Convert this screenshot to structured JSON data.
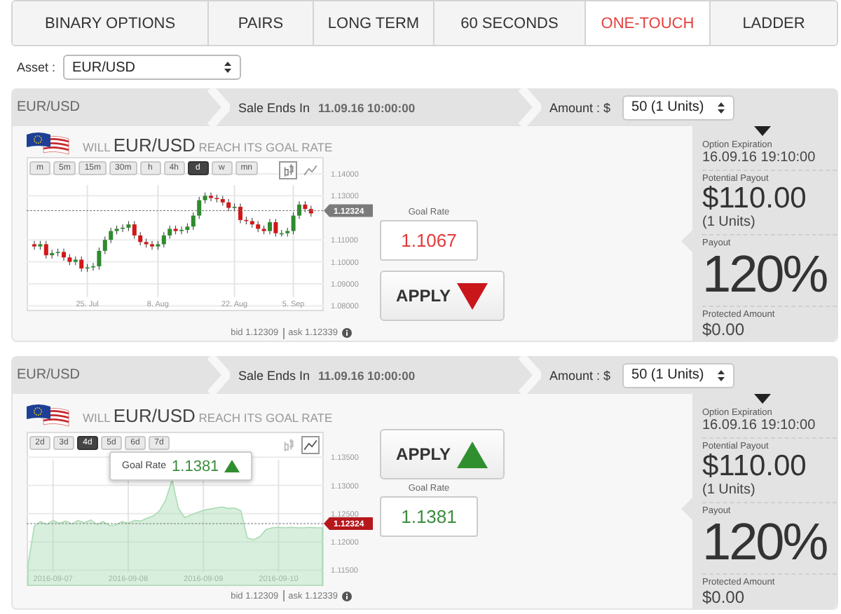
{
  "tabs": [
    {
      "label": "BINARY OPTIONS",
      "selected": false
    },
    {
      "label": "PAIRS",
      "selected": false
    },
    {
      "label": "LONG TERM",
      "selected": false
    },
    {
      "label": "60 SECONDS",
      "selected": false
    },
    {
      "label": "ONE-TOUCH",
      "selected": true
    },
    {
      "label": "LADDER",
      "selected": false
    }
  ],
  "asset": {
    "label": "Asset :",
    "value": "EUR/USD"
  },
  "panels": [
    {
      "header": {
        "symbol": "EUR/USD",
        "sale_label": "Sale Ends In",
        "sale_time": "11.09.16 10:00:00",
        "amount_label": "Amount : $",
        "amount_value": "50 (1 Units)"
      },
      "question": {
        "prefix": "WILL",
        "symbol": "EUR/USD",
        "suffix": "REACH ITS GOAL RATE"
      },
      "timeframes": [
        {
          "label": "m",
          "selected": false
        },
        {
          "label": "5m",
          "selected": false
        },
        {
          "label": "15m",
          "selected": false
        },
        {
          "label": "30m",
          "selected": false
        },
        {
          "label": "h",
          "selected": false
        },
        {
          "label": "4h",
          "selected": false
        },
        {
          "label": "d",
          "selected": true
        },
        {
          "label": "w",
          "selected": false
        },
        {
          "label": "mn",
          "selected": false
        }
      ],
      "chart_types": [
        {
          "kind": "candlestick",
          "selected": true
        },
        {
          "kind": "line",
          "selected": false
        }
      ],
      "chart_data": {
        "type": "candlestick",
        "categories": [
          null,
          null,
          null,
          null,
          null,
          null,
          null,
          null,
          null,
          "25. Jul",
          null,
          null,
          null,
          null,
          null,
          null,
          null,
          null,
          null,
          null,
          null,
          "8. Aug",
          null,
          null,
          null,
          null,
          null,
          null,
          null,
          null,
          null,
          null,
          null,
          null,
          "22. Aug",
          null,
          null,
          null,
          null,
          null,
          null,
          null,
          null,
          null,
          "5. Sep",
          null,
          null,
          null
        ],
        "ohlc": [
          [
            1.108,
            1.1095,
            1.1055,
            1.107
          ],
          [
            1.107,
            1.1095,
            1.1055,
            1.108
          ],
          [
            1.108,
            1.1095,
            1.1015,
            1.103
          ],
          [
            1.103,
            1.1055,
            1.1015,
            1.104
          ],
          [
            1.104,
            1.106,
            1.1025,
            1.1045
          ],
          [
            1.1045,
            1.106,
            1.1005,
            1.102
          ],
          [
            1.102,
            1.1035,
            1.0985,
            1.1
          ],
          [
            1.1,
            1.1025,
            1.0985,
            1.101
          ],
          [
            1.101,
            1.1025,
            1.0955,
            1.097
          ],
          [
            1.097,
            1.099,
            1.0955,
            1.0975
          ],
          [
            1.0975,
            1.0995,
            1.096,
            1.098
          ],
          [
            1.098,
            1.1065,
            1.0965,
            1.105
          ],
          [
            1.105,
            1.1115,
            1.1035,
            1.11
          ],
          [
            1.11,
            1.1155,
            1.1085,
            1.114
          ],
          [
            1.114,
            1.1165,
            1.1125,
            1.115
          ],
          [
            1.115,
            1.117,
            1.1135,
            1.1155
          ],
          [
            1.1155,
            1.1185,
            1.114,
            1.117
          ],
          [
            1.117,
            1.1185,
            1.1105,
            1.112
          ],
          [
            1.112,
            1.1135,
            1.1075,
            1.109
          ],
          [
            1.109,
            1.1105,
            1.1065,
            1.108
          ],
          [
            1.108,
            1.1095,
            1.1055,
            1.107
          ],
          [
            1.107,
            1.1095,
            1.1055,
            1.108
          ],
          [
            1.108,
            1.1135,
            1.1065,
            1.112
          ],
          [
            1.112,
            1.1165,
            1.1105,
            1.115
          ],
          [
            1.115,
            1.1165,
            1.1125,
            1.114
          ],
          [
            1.114,
            1.116,
            1.1125,
            1.1145
          ],
          [
            1.1145,
            1.1175,
            1.113,
            1.116
          ],
          [
            1.116,
            1.1225,
            1.1145,
            1.121
          ],
          [
            1.121,
            1.1295,
            1.1195,
            1.128
          ],
          [
            1.128,
            1.1315,
            1.1265,
            1.13
          ],
          [
            1.13,
            1.1315,
            1.1275,
            1.129
          ],
          [
            1.129,
            1.1305,
            1.127,
            1.1285
          ],
          [
            1.1285,
            1.13,
            1.1255,
            1.127
          ],
          [
            1.127,
            1.1285,
            1.123,
            1.1245
          ],
          [
            1.1245,
            1.1265,
            1.123,
            1.125
          ],
          [
            1.125,
            1.1265,
            1.1175,
            1.119
          ],
          [
            1.119,
            1.1205,
            1.117,
            1.1185
          ],
          [
            1.1185,
            1.12,
            1.1155,
            1.117
          ],
          [
            1.117,
            1.1185,
            1.1135,
            1.115
          ],
          [
            1.115,
            1.1165,
            1.1125,
            1.114
          ],
          [
            1.114,
            1.1195,
            1.1125,
            1.118
          ],
          [
            1.118,
            1.1195,
            1.1115,
            1.113
          ],
          [
            1.113,
            1.1145,
            1.1115,
            1.113
          ],
          [
            1.113,
            1.1155,
            1.1115,
            1.114
          ],
          [
            1.114,
            1.1225,
            1.1125,
            1.121
          ],
          [
            1.121,
            1.1275,
            1.1195,
            1.126
          ],
          [
            1.126,
            1.1275,
            1.1225,
            1.124
          ],
          [
            1.124,
            1.1255,
            1.1205,
            1.122
          ]
        ],
        "ylim": [
          1.0776,
          1.1476
        ],
        "grid": true,
        "yticks": [
          {
            "value": 1.14,
            "label": "1.14000"
          },
          {
            "value": 1.13,
            "label": "1.13000"
          },
          {
            "value": 1.11,
            "label": "1.11000"
          },
          {
            "value": 1.1,
            "label": "1.10000"
          },
          {
            "value": 1.09,
            "label": "1.09000"
          },
          {
            "value": 1.08,
            "label": "1.08000"
          }
        ]
      },
      "price_marker": {
        "label": "1.12324",
        "color": "#7b7b7b"
      },
      "rising": false,
      "goal_label": "Goal Rate",
      "goal_value": "1.1067",
      "apply_label": "APPLY",
      "bid": "bid 1.12309",
      "ask": "ask 1.12339",
      "summary": {
        "expiration_label": "Option Expiration",
        "expiration": "16.09.16 19:10:00",
        "payout_label": "Potential Payout",
        "payout": "$110.00",
        "units": "(1 Units)",
        "percent_label": "Payout",
        "percent": "120%",
        "protected_label": "Protected Amount",
        "protected": "$0.00"
      }
    },
    {
      "header": {
        "symbol": "EUR/USD",
        "sale_label": "Sale Ends In",
        "sale_time": "11.09.16 10:00:00",
        "amount_label": "Amount : $",
        "amount_value": "50 (1 Units)"
      },
      "question": {
        "prefix": "WILL",
        "symbol": "EUR/USD",
        "suffix": "REACH ITS GOAL RATE"
      },
      "timeframes": [
        {
          "label": "2d",
          "selected": false
        },
        {
          "label": "3d",
          "selected": false
        },
        {
          "label": "4d",
          "selected": true
        },
        {
          "label": "5d",
          "selected": false
        },
        {
          "label": "6d",
          "selected": false
        },
        {
          "label": "7d",
          "selected": false
        }
      ],
      "chart_types": [
        {
          "kind": "candlestick",
          "selected": false
        },
        {
          "kind": "line",
          "selected": true
        }
      ],
      "chart_data": {
        "type": "area",
        "categories": [
          null,
          null,
          null,
          null,
          "2016-09-07",
          null,
          null,
          null,
          null,
          null,
          null,
          null,
          null,
          null,
          null,
          null,
          "2016-09-08",
          null,
          null,
          null,
          null,
          null,
          null,
          null,
          null,
          null,
          null,
          null,
          "2016-09-09",
          null,
          null,
          null,
          null,
          null,
          null,
          null,
          null,
          null,
          null,
          null,
          "2016-09-10",
          null,
          null,
          null,
          null,
          null,
          null,
          null
        ],
        "series": [
          {
            "color": "#a9dbb3",
            "values": [
              1.116,
              1.1228,
              1.1236,
              1.1231,
              1.1238,
              1.1233,
              1.1237,
              1.1232,
              1.1238,
              1.1234,
              1.1239,
              1.1231,
              1.1236,
              1.1229,
              1.123,
              1.1236,
              1.1233,
              1.1238,
              1.1237,
              1.1242,
              1.1246,
              1.1255,
              1.1275,
              1.131,
              1.126,
              1.1243,
              1.1248,
              1.1252,
              1.1256,
              1.1258,
              1.126,
              1.1262,
              1.1259,
              1.126,
              1.1255,
              1.1207,
              1.1204,
              1.1209,
              1.1222,
              1.1225,
              1.1226,
              1.1225,
              1.1226,
              1.1225,
              1.1225,
              1.1226,
              1.1225,
              1.1225
            ]
          }
        ],
        "ylim": [
          1.1122,
          1.1395
        ],
        "grid": true,
        "yticks": [
          {
            "value": 1.135,
            "label": "1.13500"
          },
          {
            "value": 1.13,
            "label": "1.13000"
          },
          {
            "value": 1.125,
            "label": "1.12500"
          },
          {
            "value": 1.12,
            "label": "1.12000"
          },
          {
            "value": 1.115,
            "label": "1.11500"
          }
        ]
      },
      "tooltip": {
        "label": "Goal Rate",
        "value": "1.1381"
      },
      "price_marker": {
        "label": "1.12324",
        "color": "#b5171c"
      },
      "rising": true,
      "goal_label": "Goal Rate",
      "goal_value": "1.1381",
      "apply_label": "APPLY",
      "bid": "bid 1.12309",
      "ask": "ask 1.12339",
      "summary": {
        "expiration_label": "Option Expiration",
        "expiration": "16.09.16 19:10:00",
        "payout_label": "Potential Payout",
        "payout": "$110.00",
        "units": "(1 Units)",
        "percent_label": "Payout",
        "percent": "120%",
        "protected_label": "Protected Amount",
        "protected": "$0.00"
      }
    }
  ]
}
